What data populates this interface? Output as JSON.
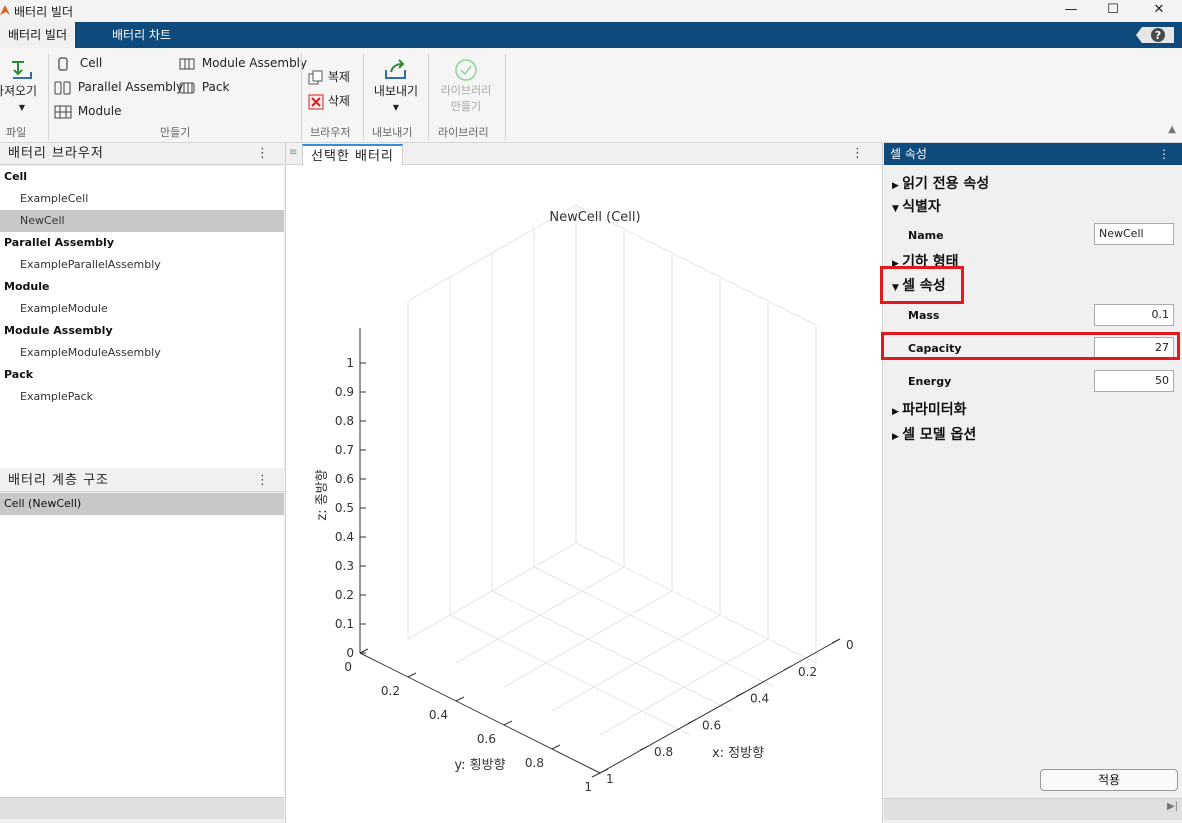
{
  "window": {
    "title": "배터리 빌더",
    "minimize": "—",
    "maximize": "☐",
    "close": "✕"
  },
  "tabs": [
    {
      "label": "배터리 빌더"
    },
    {
      "label": "배터리 차트"
    }
  ],
  "toolstrip": {
    "import_label": "가져오기",
    "file_section": "파일",
    "cell": "Cell",
    "parallel_assembly": "Parallel Assembly",
    "module": "Module",
    "module_assembly": "Module Assembly",
    "pack": "Pack",
    "create_section": "만들기",
    "copy": "복제",
    "delete": "삭제",
    "browser_section": "브라우저",
    "export": "내보내기",
    "export_section": "내보내기",
    "library_create_line1": "라이브러리",
    "library_create_line2": "만들기",
    "library_section": "라이브러리"
  },
  "browser": {
    "title": "배터리 브라우저",
    "items": [
      {
        "label": "Cell",
        "kind": "group"
      },
      {
        "label": "ExampleCell",
        "kind": "leaf"
      },
      {
        "label": "NewCell",
        "kind": "leaf",
        "selected": true
      },
      {
        "label": "Parallel Assembly",
        "kind": "group"
      },
      {
        "label": "ExampleParallelAssembly",
        "kind": "leaf"
      },
      {
        "label": "Module",
        "kind": "group"
      },
      {
        "label": "ExampleModule",
        "kind": "leaf"
      },
      {
        "label": "Module Assembly",
        "kind": "group"
      },
      {
        "label": "ExampleModuleAssembly",
        "kind": "leaf"
      },
      {
        "label": "Pack",
        "kind": "group"
      },
      {
        "label": "ExamplePack",
        "kind": "leaf"
      }
    ]
  },
  "hierarchy": {
    "title": "배터리 계층 구조",
    "items": [
      {
        "label": "Cell (NewCell)"
      }
    ]
  },
  "center": {
    "tab": "선택한 배터리",
    "plot": {
      "title": "NewCell (Cell)",
      "xlabel": "x: 정방향",
      "ylabel": "y: 횡방향",
      "zlabel": "z: 종방향",
      "z_ticks": [
        "0",
        "0.1",
        "0.2",
        "0.3",
        "0.4",
        "0.5",
        "0.6",
        "0.7",
        "0.8",
        "0.9",
        "1"
      ],
      "x_ticks": [
        "0",
        "0.2",
        "0.4",
        "0.6",
        "0.8",
        "1"
      ],
      "y_ticks": [
        "0",
        "0.2",
        "0.4",
        "0.6",
        "0.8",
        "1"
      ]
    }
  },
  "properties": {
    "title": "셀 속성",
    "readonly_section": "읽기 전용 속성",
    "identifier_section": "식별자",
    "name_label": "Name",
    "name_value": "NewCell",
    "geometry_section": "기하 형태",
    "cell_section": "셀 속성",
    "mass_label": "Mass",
    "mass_value": "0.1",
    "capacity_label": "Capacity",
    "capacity_value": "27",
    "energy_label": "Energy",
    "energy_value": "50",
    "param_section": "파라미터화",
    "model_section": "셀 모델 옵션",
    "apply": "적용"
  },
  "colors": {
    "accent": "#0e4a7c",
    "highlight": "#e0191f",
    "selection": "#c8c8c8"
  }
}
